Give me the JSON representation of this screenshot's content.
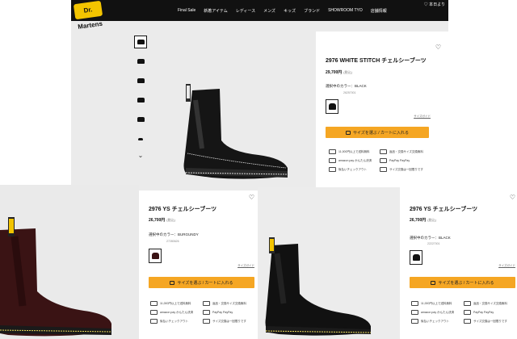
{
  "nav": {
    "logo": "Dr. Martens",
    "items": [
      "Final Sale",
      "新着アイテム",
      "レディース",
      "メンズ",
      "キッズ",
      "ブランド",
      "SHOWROOM TYO",
      "店舗情報"
    ],
    "right": "♡ 本日より"
  },
  "panels": {
    "top": {
      "title": "2976 WHITE STITCH チェルシーブーツ",
      "price": "29,700円",
      "tax": "(税込)",
      "color_label": "選択中のカラー：BLACK",
      "code": "26257001",
      "size_guide": "サイズガイド",
      "cart_label": "サイズを選ぶ / カートに入れる",
      "features": [
        "11,000円以上で送料無料",
        "返品・交換サイズ交換無料",
        "amazon pay かんたん決済",
        "PayPay PayPay",
        "後払いチェックアウト",
        "サイズ交換は一回限りです"
      ]
    },
    "left": {
      "title": "2976 YS チェルシーブーツ",
      "price": "26,700円",
      "tax": "(税込)",
      "color_label": "選択中のカラー：BURGUNDY",
      "code": "27280626",
      "size_guide": "サイズガイド",
      "cart_label": "サイズを選ぶ / カートに入れる",
      "features": [
        "11,000円以上で送料無料",
        "返品・交換サイズ交換無料",
        "amazon pay かんたん決済",
        "PayPay PayPay",
        "後払いチェックアウト",
        "サイズ交換は一回限りです"
      ]
    },
    "right": {
      "title": "2976 YS チェルシーブーツ",
      "price": "26,700円",
      "tax": "(税込)",
      "color_label": "選択中のカラー：BLACK",
      "code": "22227001",
      "size_guide": "サイズガイド",
      "cart_label": "サイズを選ぶ / カートに入れる",
      "features": [
        "11,000円以上で送料無料",
        "返品・交換サイズ交換無料",
        "amazon pay かんたん決済",
        "PayPay PayPay",
        "後払いチェックアウト",
        "サイズ交換は一回限りです"
      ]
    }
  },
  "colors": {
    "cart": "#f5a623",
    "nav_bg": "#111111",
    "gallery_bg": "#ebebeb"
  }
}
